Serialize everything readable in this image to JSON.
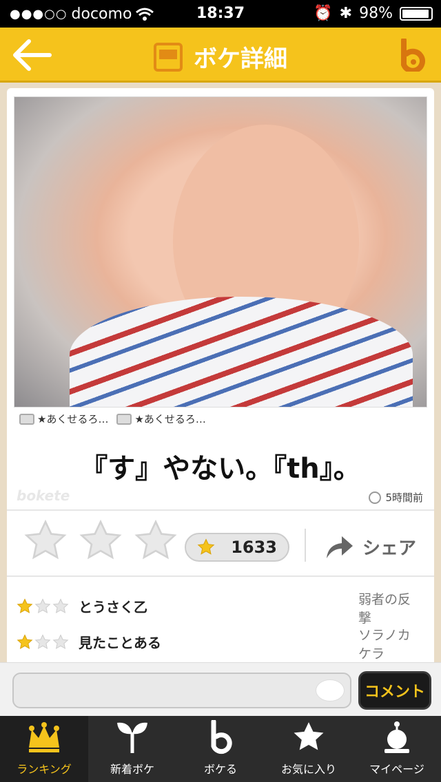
{
  "status": {
    "carrier": "docomo",
    "time": "18:37",
    "battery": "98%"
  },
  "header": {
    "title": "ボケ詳細"
  },
  "post": {
    "credit_photo": "★あくせるろ…",
    "credit_image": "★あくせるろ…",
    "boke_text": "『す』やない。『th』。",
    "watermark": "bokete",
    "time_ago": "5時間前",
    "star_count": "1633",
    "share_label": "シェア"
  },
  "comments": [
    {
      "text": "とうさく乙",
      "user": "弱者の反撃",
      "stars": 1
    },
    {
      "text": "見たことある",
      "user": "ソラノカケラ",
      "stars": 1
    }
  ],
  "comment_input": {
    "placeholder": "",
    "button_label": "コメント"
  },
  "tabs": [
    {
      "label": "ランキング",
      "icon": "crown-icon",
      "active": true
    },
    {
      "label": "新着ボケ",
      "icon": "sprout-icon",
      "active": false
    },
    {
      "label": "ボケる",
      "icon": "bokete-b-icon",
      "active": false
    },
    {
      "label": "お気に入り",
      "icon": "star-icon",
      "active": false
    },
    {
      "label": "マイページ",
      "icon": "profile-icon",
      "active": false
    }
  ],
  "colors": {
    "accent": "#f5c31c",
    "tab_bg": "#2c2c2c",
    "button_text": "#f5c31c"
  }
}
